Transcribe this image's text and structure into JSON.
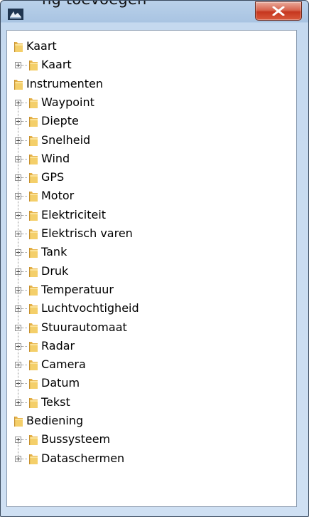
{
  "window": {
    "title_partial": "ng toevoegen",
    "close_label": "X"
  },
  "tree": [
    {
      "label": "Kaart",
      "children": [
        {
          "label": "Kaart"
        }
      ]
    },
    {
      "label": "Instrumenten",
      "children": [
        {
          "label": "Waypoint"
        },
        {
          "label": "Diepte"
        },
        {
          "label": "Snelheid"
        },
        {
          "label": "Wind"
        },
        {
          "label": "GPS"
        },
        {
          "label": "Motor"
        },
        {
          "label": "Elektriciteit"
        },
        {
          "label": "Elektrisch varen"
        },
        {
          "label": "Tank"
        },
        {
          "label": "Druk"
        },
        {
          "label": "Temperatuur"
        },
        {
          "label": "Luchtvochtigheid"
        },
        {
          "label": "Stuurautomaat"
        },
        {
          "label": "Radar"
        },
        {
          "label": "Camera"
        },
        {
          "label": "Datum"
        },
        {
          "label": "Tekst"
        }
      ]
    },
    {
      "label": "Bediening",
      "children": [
        {
          "label": "Bussysteem"
        },
        {
          "label": "Dataschermen"
        }
      ]
    }
  ]
}
